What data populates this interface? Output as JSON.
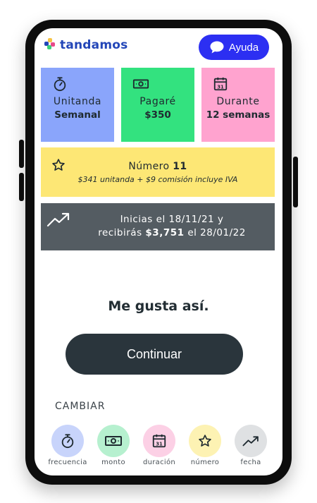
{
  "app": {
    "logo_text": "tandamos",
    "help_label": "Ayuda"
  },
  "cards": [
    {
      "label": "Unitanda",
      "value": "Semanal",
      "icon": "stopwatch-icon",
      "color": "#8aa5fb"
    },
    {
      "label": "Pagaré",
      "value": "$350",
      "icon": "cash-icon",
      "color": "#33e27f"
    },
    {
      "label": "Durante",
      "value": "12 semanas",
      "icon": "calendar-icon",
      "color": "#ffa3cf"
    }
  ],
  "number_box": {
    "prefix": "Número",
    "number": "11",
    "detail": "$341 unitanda + $9 comisión incluye IVA",
    "icon": "star-icon",
    "color": "#fde775"
  },
  "date_box": {
    "line1": "Inicias el 18/11/21 y",
    "line2_prefix": "recibirás",
    "amount": "$3,751",
    "line2_suffix": "el 28/01/22",
    "icon": "trending-up-icon",
    "color": "#545c62"
  },
  "like_text": "Me gusta así.",
  "continue_label": "Continuar",
  "change": {
    "title": "CAMBIAR",
    "items": [
      {
        "label": "frecuencia",
        "icon": "stopwatch-icon",
        "color": "#c8d4fb"
      },
      {
        "label": "monto",
        "icon": "cash-icon",
        "color": "#b6f0cf"
      },
      {
        "label": "duración",
        "icon": "calendar-icon",
        "color": "#fcd0e5"
      },
      {
        "label": "número",
        "icon": "star-icon",
        "color": "#fdf2b3"
      },
      {
        "label": "fecha",
        "icon": "trending-up-icon",
        "color": "#dfe1e3"
      }
    ]
  },
  "calendar_day": "31"
}
